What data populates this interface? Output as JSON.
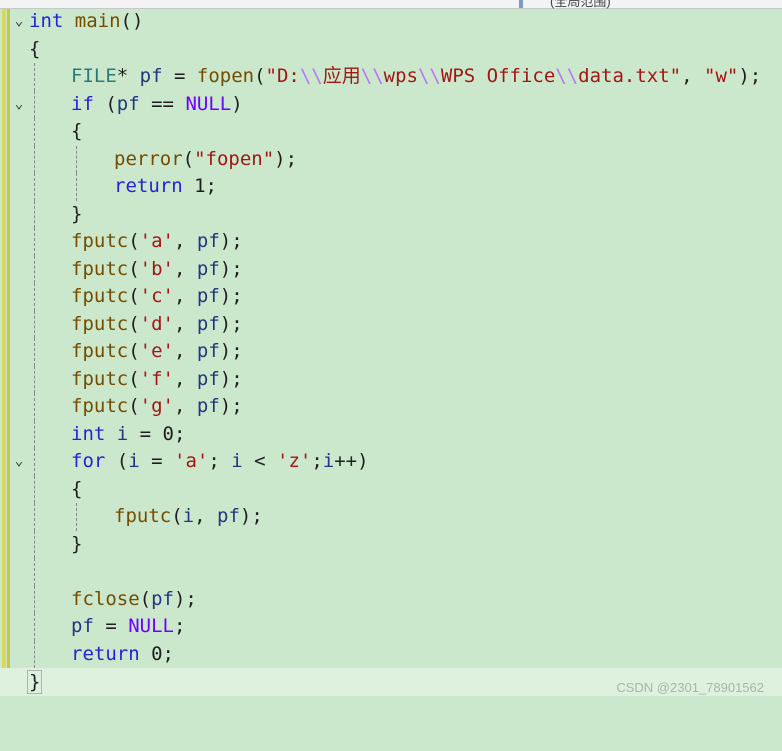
{
  "header": {
    "hint": "(全局范围)"
  },
  "icons": {
    "fold_open": "chevron-down-icon"
  },
  "colors": {
    "background": "#cce8cc",
    "keyword": "#2222dd",
    "string": "#a31515"
  },
  "code": {
    "l1": {
      "kw": "int",
      "fn": "main",
      "p": "()"
    },
    "l2": "{",
    "l3": {
      "type": "FILE",
      "a": "* ",
      "var": "pf",
      "b": " = ",
      "fn": "fopen",
      "c": "(",
      "s1": "\"D:",
      "e1": "\\\\",
      "s2": "应用",
      "e2": "\\\\",
      "s3": "wps",
      "e3": "\\\\",
      "s4": "WPS Office",
      "e4": "\\\\",
      "s5": "data.txt\"",
      "d": ", ",
      "s6": "\"w\"",
      "f": ");"
    },
    "l4": {
      "kw": "if",
      "a": " (",
      "var": "pf",
      "b": " == ",
      "mac": "NULL",
      "c": ")"
    },
    "l5": "{",
    "l6": {
      "fn": "perror",
      "a": "(",
      "s": "\"fopen\"",
      "b": ");"
    },
    "l7": {
      "kw": "return",
      "a": " 1;"
    },
    "l8": "}",
    "fputc_lines": [
      {
        "fn": "fputc",
        "a": "(",
        "s": "'a'",
        "b": ", ",
        "var": "pf",
        "c": ");"
      },
      {
        "fn": "fputc",
        "a": "(",
        "s": "'b'",
        "b": ", ",
        "var": "pf",
        "c": ");"
      },
      {
        "fn": "fputc",
        "a": "(",
        "s": "'c'",
        "b": ", ",
        "var": "pf",
        "c": ");"
      },
      {
        "fn": "fputc",
        "a": "(",
        "s": "'d'",
        "b": ", ",
        "var": "pf",
        "c": ");"
      },
      {
        "fn": "fputc",
        "a": "(",
        "s": "'e'",
        "b": ", ",
        "var": "pf",
        "c": ");"
      },
      {
        "fn": "fputc",
        "a": "(",
        "s": "'f'",
        "b": ", ",
        "var": "pf",
        "c": ");"
      },
      {
        "fn": "fputc",
        "a": "(",
        "s": "'g'",
        "b": ", ",
        "var": "pf",
        "c": ");"
      }
    ],
    "l16": {
      "kw": "int",
      "var": " i",
      "a": " = 0;"
    },
    "l17": {
      "kw": "for",
      "a": " (",
      "v1": "i",
      "b": " = ",
      "s1": "'a'",
      "c": "; ",
      "v2": "i",
      "d": " < ",
      "s2": "'z'",
      "e": ";",
      "v3": "i",
      "f": "++)"
    },
    "l18": "{",
    "l19": {
      "fn": "fputc",
      "a": "(",
      "v1": "i",
      "b": ", ",
      "v2": "pf",
      "c": ");"
    },
    "l20": "}",
    "l22": {
      "fn": "fclose",
      "a": "(",
      "var": "pf",
      "b": ");"
    },
    "l23": {
      "var": "pf",
      "a": " = ",
      "mac": "NULL",
      "b": ";"
    },
    "l24": {
      "kw": "return",
      "a": " 0;"
    },
    "l25": "}"
  },
  "watermark": "CSDN @2301_78901562"
}
